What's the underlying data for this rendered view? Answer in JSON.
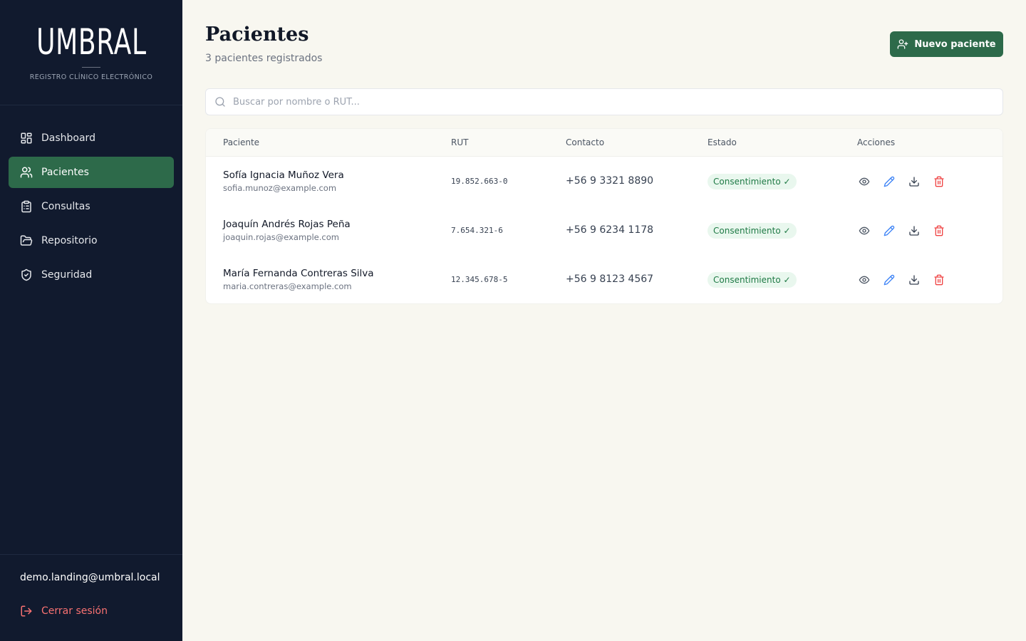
{
  "brand": {
    "logo": "UMBRAL",
    "tagline": "REGISTRO CLÍNICO ELECTRÓNICO"
  },
  "nav": {
    "items": [
      {
        "label": "Dashboard",
        "icon": "dashboard-icon",
        "active": false
      },
      {
        "label": "Pacientes",
        "icon": "users-icon",
        "active": true
      },
      {
        "label": "Consultas",
        "icon": "clipboard-icon",
        "active": false
      },
      {
        "label": "Repositorio",
        "icon": "folder-icon",
        "active": false
      },
      {
        "label": "Seguridad",
        "icon": "shield-check-icon",
        "active": false
      }
    ]
  },
  "user": {
    "email": "demo.landing@umbral.local",
    "logout_label": "Cerrar sesión"
  },
  "header": {
    "title": "Pacientes",
    "subtitle": "3 pacientes registrados",
    "new_button_label": "Nuevo paciente"
  },
  "search": {
    "placeholder": "Buscar por nombre o RUT...",
    "value": ""
  },
  "table": {
    "columns": [
      "Paciente",
      "RUT",
      "Contacto",
      "Estado",
      "Acciones"
    ],
    "rows": [
      {
        "name": "Sofía Ignacia Muñoz Vera",
        "email": "sofia.munoz@example.com",
        "rut": "19.852.663-0",
        "phone": "+56 9 3321 8890",
        "status": "Consentimiento ✓"
      },
      {
        "name": "Joaquín Andrés Rojas Peña",
        "email": "joaquin.rojas@example.com",
        "rut": "7.654.321-6",
        "phone": "+56 9 6234 1178",
        "status": "Consentimiento ✓"
      },
      {
        "name": "María Fernanda Contreras Silva",
        "email": "maria.contreras@example.com",
        "rut": "12.345.678-5",
        "phone": "+56 9 8123 4567",
        "status": "Consentimiento ✓"
      }
    ]
  },
  "colors": {
    "sidebar_bg": "#111a2e",
    "accent_green": "#2d6a4a",
    "page_bg": "#f8f7f0",
    "badge_bg": "#e9f7ee",
    "badge_text": "#1f7a45",
    "danger": "#ef4444",
    "edit_blue": "#3b82f6"
  }
}
